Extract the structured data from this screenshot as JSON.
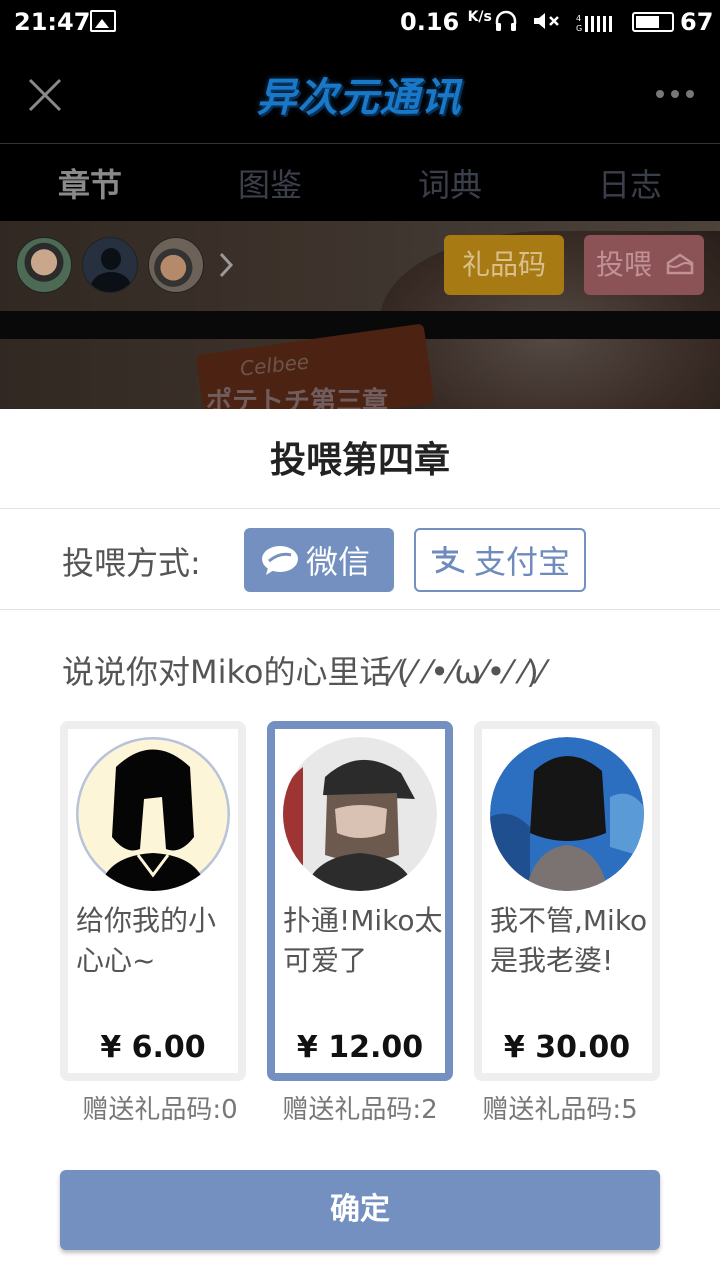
{
  "status_bar": {
    "time": "21:47",
    "net_speed": "0.16",
    "net_speed_unit": "K/s",
    "battery": "67",
    "battery_fraction": 0.67,
    "icons": [
      "image-icon",
      "headphones-icon",
      "mute-icon",
      "signal-icon",
      "battery-icon"
    ]
  },
  "header": {
    "logo_text": "异次元通讯",
    "close_icon": "close-icon",
    "more_icon": "more-icon"
  },
  "tabs": [
    {
      "label": "章节",
      "active": true
    },
    {
      "label": "图鉴",
      "active": false
    },
    {
      "label": "词典",
      "active": false
    },
    {
      "label": "日志",
      "active": false
    }
  ],
  "banner": {
    "gift_code_label": "礼品码",
    "feed_label": "投喂",
    "can_text": "Celbee",
    "chapter_peek": "ポテトチ第三章"
  },
  "sheet": {
    "title": "投喂第四章",
    "pay_label": "投喂方式:",
    "pay_methods": [
      {
        "label": "微信",
        "selected": true
      },
      {
        "label": "支付宝",
        "selected": false
      }
    ],
    "message": "说说你对Miko的心里话⁄(⁄ ⁄•⁄ω⁄•⁄ ⁄)⁄",
    "options": [
      {
        "caption": "给你我的小心心~",
        "price": "¥ 6.00",
        "bonus": "赠送礼品码:0",
        "selected": false
      },
      {
        "caption": "扑通!Miko太可爱了",
        "price": "¥ 12.00",
        "bonus": "赠送礼品码:2",
        "selected": true
      },
      {
        "caption": "我不管,Miko是我老婆!",
        "price": "¥ 30.00",
        "bonus": "赠送礼品码:5",
        "selected": false
      }
    ],
    "confirm_label": "确定"
  },
  "colors": {
    "accent": "#7390c0",
    "gift_code_bg": "#a87a14",
    "feed_bg": "#8c5357"
  }
}
